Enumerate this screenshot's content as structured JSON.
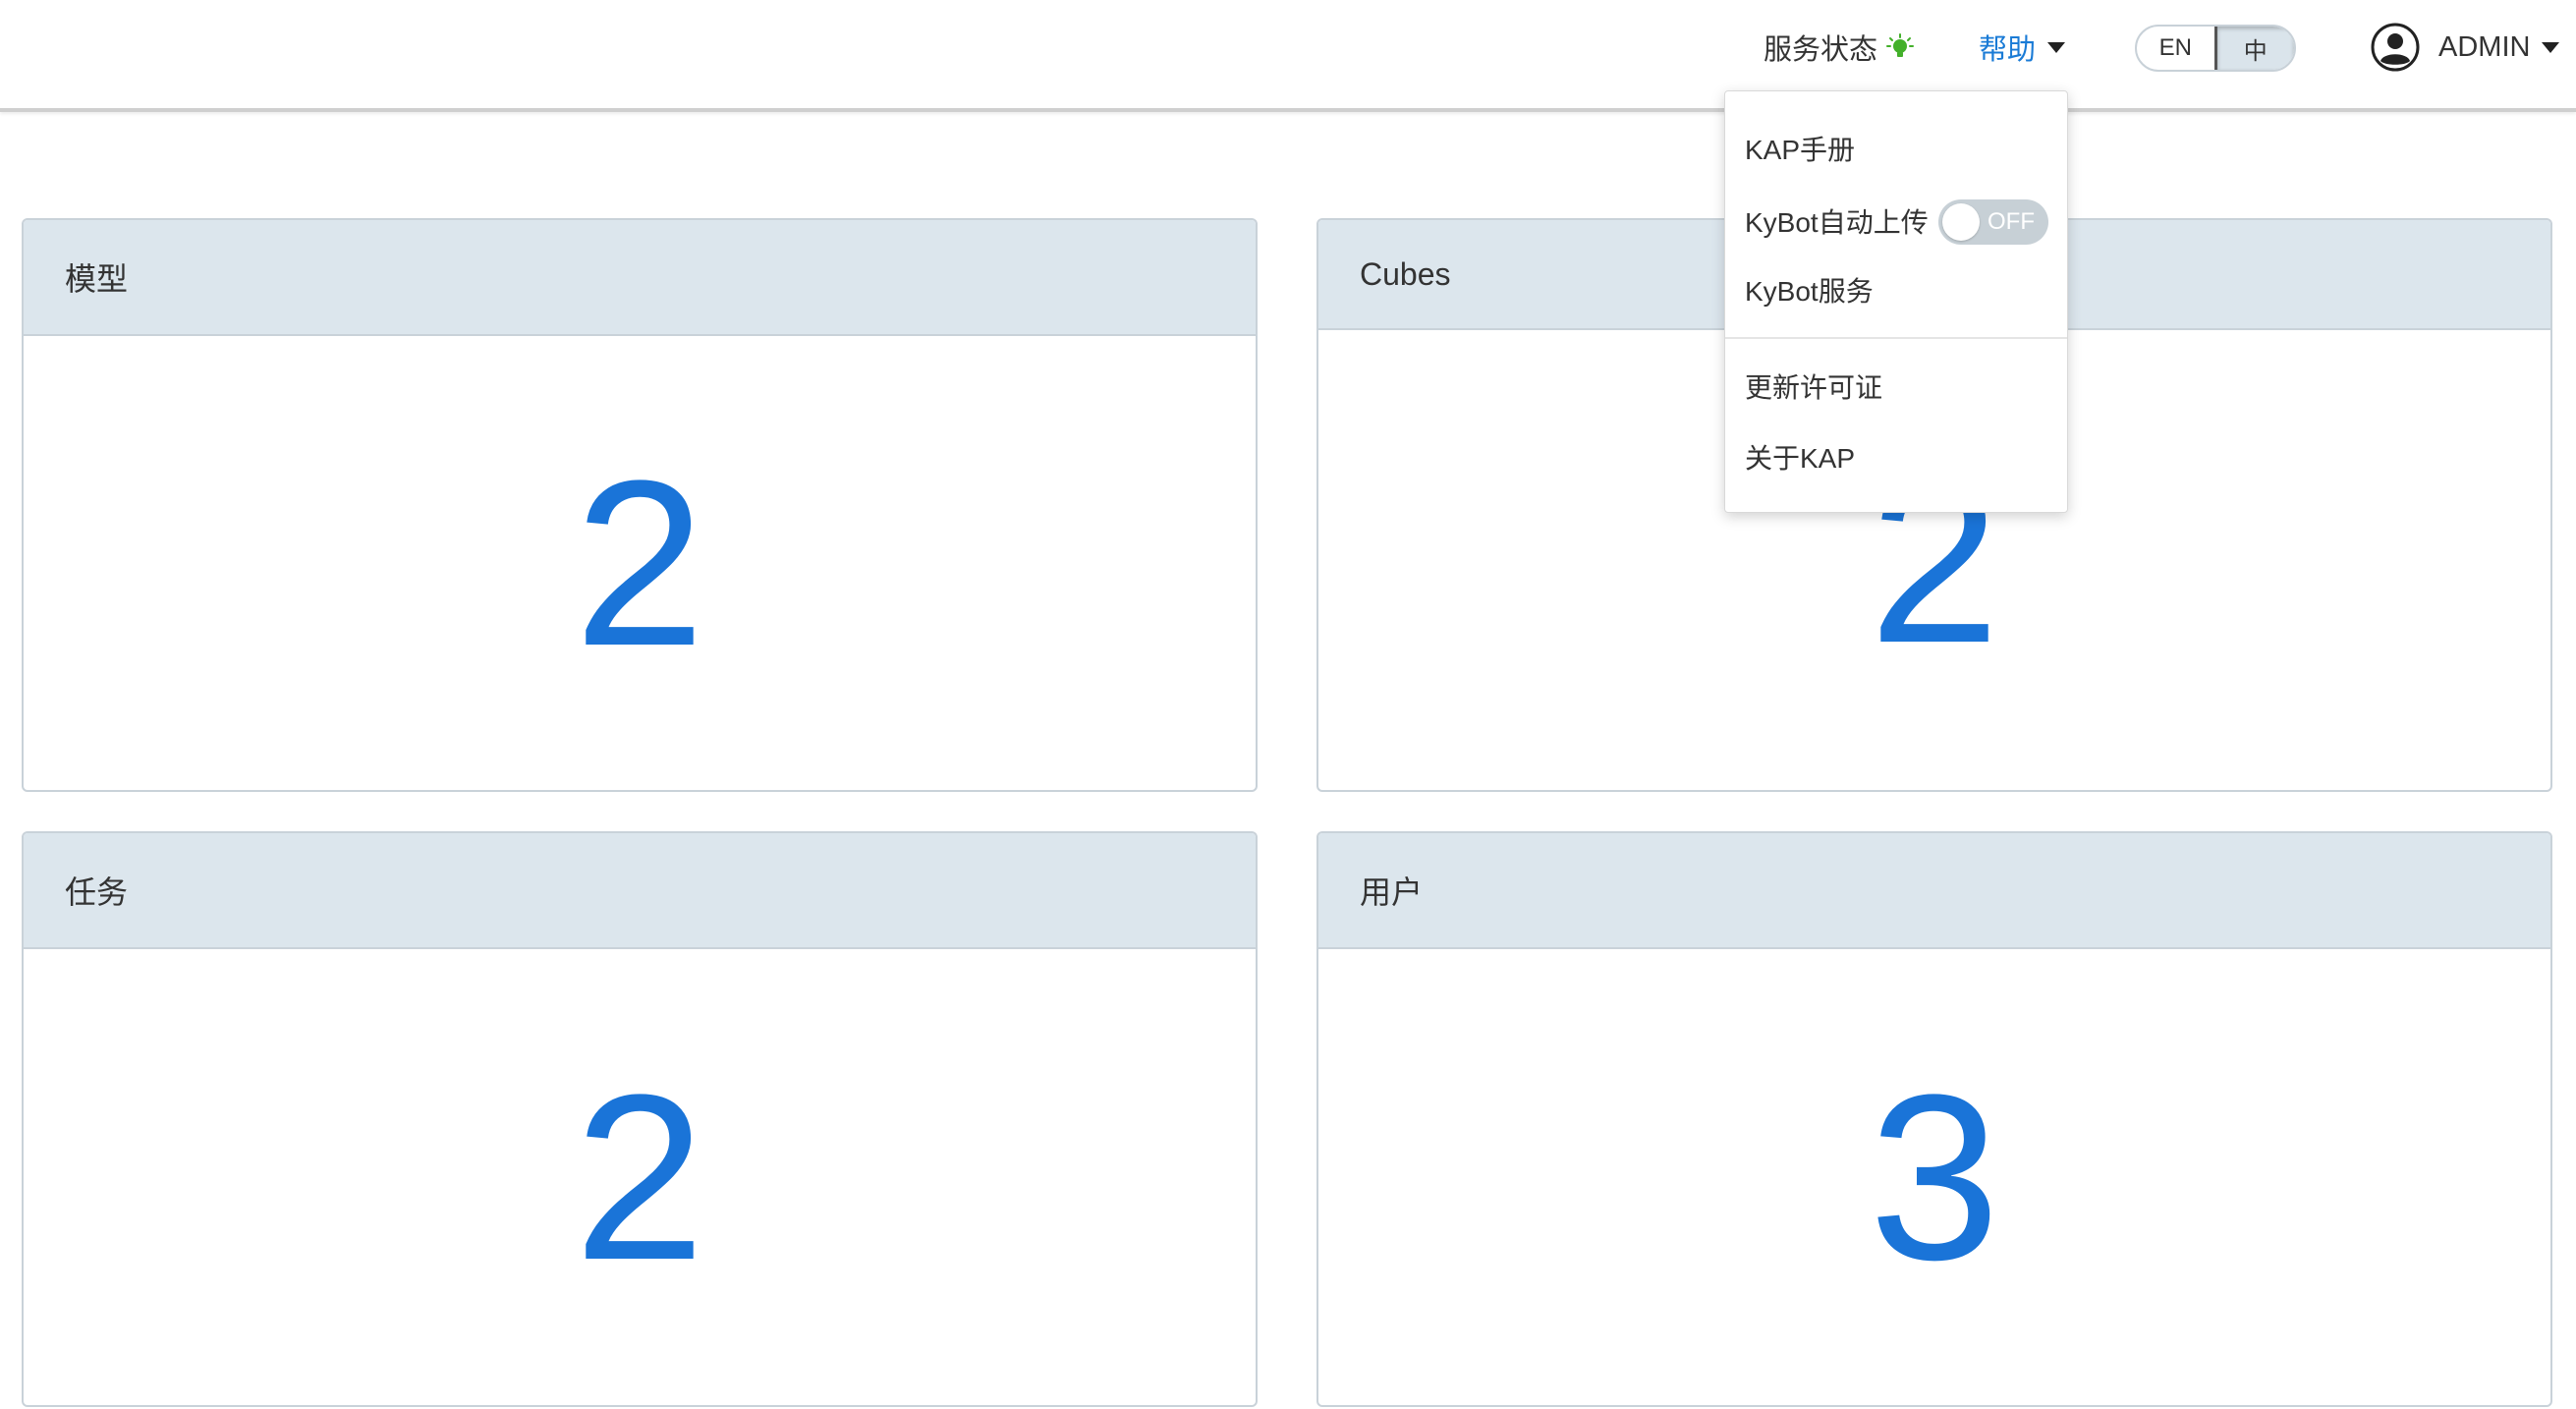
{
  "header": {
    "service_status_label": "服务状态",
    "service_status_color": "#43b02a",
    "help_label": "帮助",
    "help_color": "#1a7bd6",
    "lang_options": [
      "EN",
      "中"
    ],
    "lang_selected": "中",
    "user_label": "ADMIN"
  },
  "help_menu": {
    "items": [
      "KAP手册",
      "KyBot自动上传",
      "KyBot服务",
      "更新许可证",
      "关于KAP"
    ],
    "kybot_toggle_label": "OFF",
    "kybot_toggle_on": false
  },
  "cards": {
    "models": {
      "title": "模型",
      "value": "2"
    },
    "cubes": {
      "title": "Cubes",
      "value": "2"
    },
    "jobs": {
      "title": "任务",
      "value": "2"
    },
    "users": {
      "title": "用户",
      "value": "3"
    }
  },
  "colors": {
    "number": "#1a74d8",
    "card_header_bg": "#dce6ed"
  },
  "icons": {
    "status": "lightbulb-icon",
    "help_caret": "caret-down-icon",
    "user_avatar": "user-circle-icon",
    "user_caret": "caret-down-icon"
  }
}
